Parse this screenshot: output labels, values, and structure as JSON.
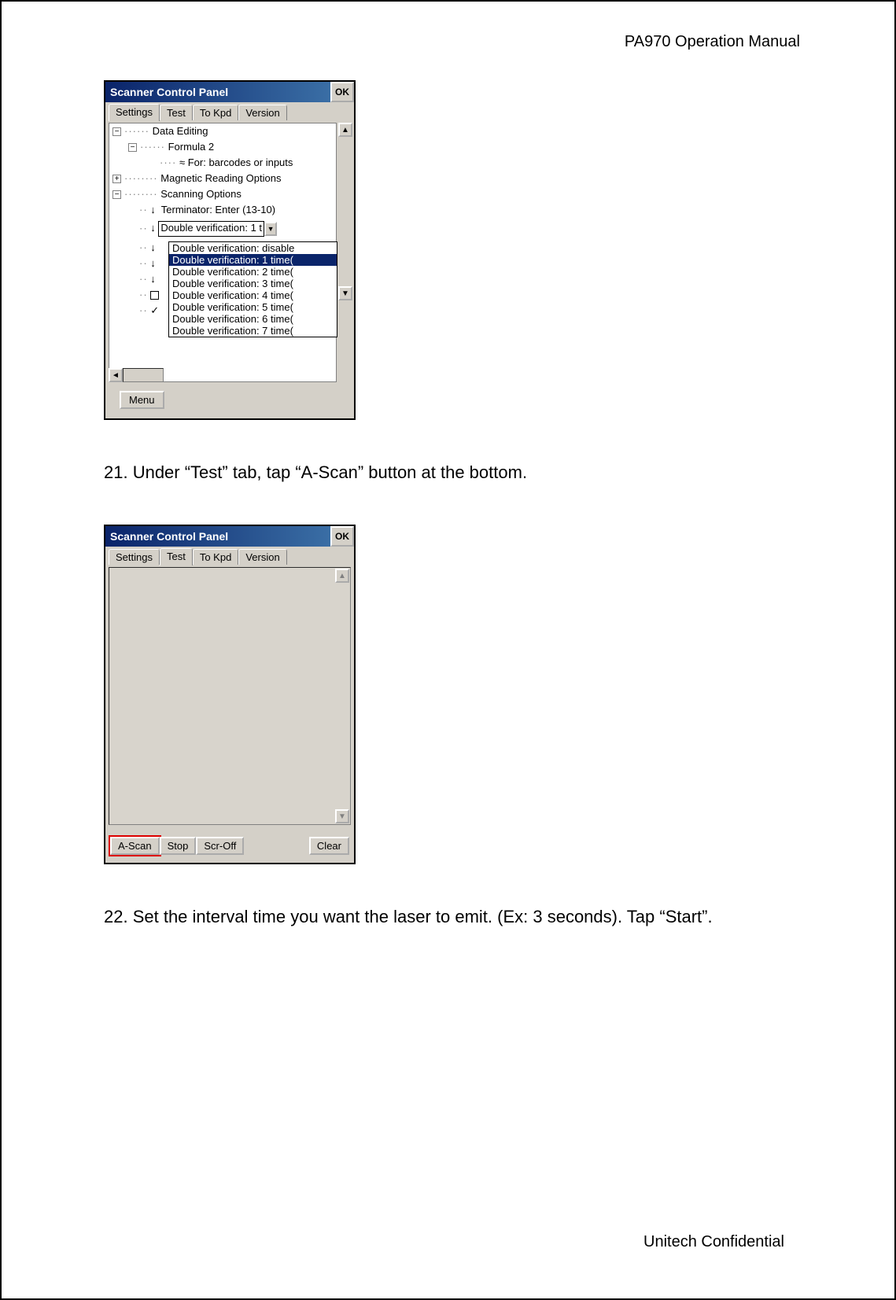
{
  "header": "PA970 Operation Manual",
  "footer": "Unitech Confidential",
  "screenshot1": {
    "title": "Scanner Control Panel",
    "ok": "OK",
    "tabs": {
      "settings": "Settings",
      "test": "Test",
      "tokpd": "To Kpd",
      "version": "Version"
    },
    "tree": {
      "l1": "Data Editing",
      "l2": "Formula 2",
      "l3": "For: barcodes or inputs",
      "l4": "Magnetic Reading Options",
      "l5": "Scanning Options",
      "l6": "Terminator: Enter (13-10)",
      "combo": "Double verification: 1 t"
    },
    "dropdown": {
      "i0": "Double verification: disable",
      "i1": "Double verification: 1 time(",
      "i2": "Double verification: 2 time(",
      "i3": "Double verification: 3 time(",
      "i4": "Double verification: 4 time(",
      "i5": "Double verification: 5 time(",
      "i6": "Double verification: 6 time(",
      "i7": "Double verification: 7 time("
    },
    "menu": "Menu"
  },
  "step21": "21. Under “Test” tab, tap “A-Scan” button at the bottom.",
  "screenshot2": {
    "title": "Scanner Control Panel",
    "ok": "OK",
    "tabs": {
      "settings": "Settings",
      "test": "Test",
      "tokpd": "To Kpd",
      "version": "Version"
    },
    "buttons": {
      "ascan": "A-Scan",
      "stop": "Stop",
      "scroff": "Scr-Off",
      "clear": "Clear"
    }
  },
  "step22": "22. Set the interval time you want the laser to emit. (Ex: 3 seconds). Tap “Start”."
}
